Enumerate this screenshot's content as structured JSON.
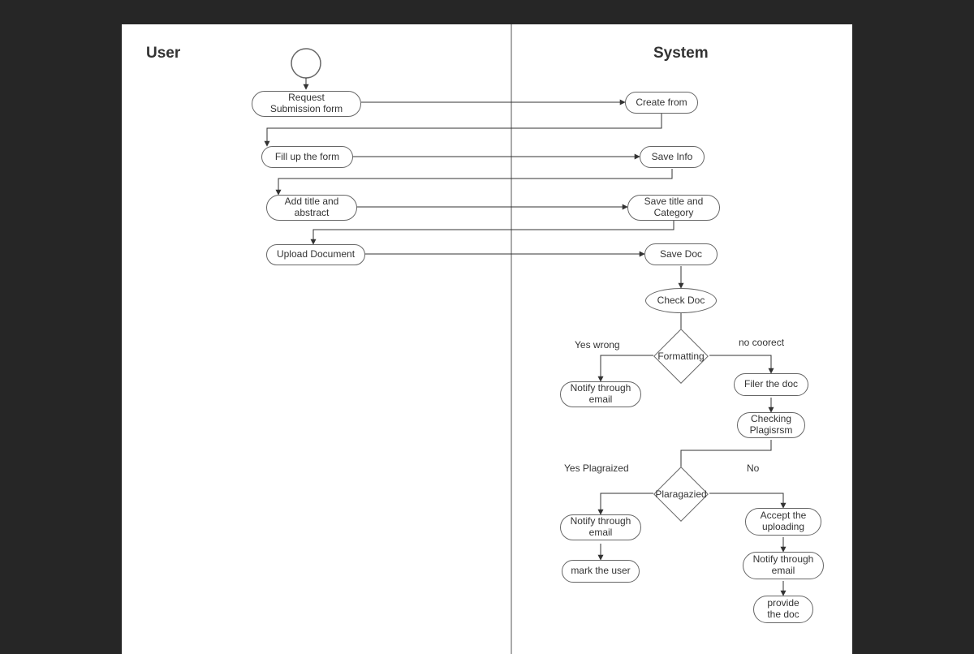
{
  "titles": {
    "user": "User",
    "system": "System"
  },
  "nodes": {
    "request": "Request\nSubmission form",
    "createForm": "Create from",
    "fillForm": "Fill up the form",
    "saveInfo": "Save Info",
    "addTitle": "Add title and\nabstract",
    "saveTitle": "Save title and\nCategory",
    "uploadDoc": "Upload Document",
    "saveDoc": "Save Doc",
    "checkDoc": "Check Doc",
    "notify1": "Notify through\nemail",
    "filterDoc": "Filer the doc",
    "checkPlag": "Checking\nPlagisrsm",
    "notify2": "Notify through\nemail",
    "markUser": "mark the user",
    "accept": "Accept the\nuploading",
    "notify3": "Notify through\nemail",
    "provide": "provide\nthe doc"
  },
  "diamonds": {
    "formatting": "Formatting",
    "plagiarized": "Plaragazied"
  },
  "edgeLabels": {
    "yesWrong": "Yes wrong",
    "noCorrect": "no coorect",
    "yesPlag": "Yes Plagraized",
    "no": "No"
  },
  "chart_data": {
    "type": "activity-diagram",
    "swimlanes": [
      "User",
      "System"
    ],
    "nodes": [
      {
        "id": "start",
        "lane": "User",
        "type": "initial"
      },
      {
        "id": "request",
        "lane": "User",
        "label": "Request Submission form"
      },
      {
        "id": "createForm",
        "lane": "System",
        "label": "Create from"
      },
      {
        "id": "fillForm",
        "lane": "User",
        "label": "Fill up the form"
      },
      {
        "id": "saveInfo",
        "lane": "System",
        "label": "Save Info"
      },
      {
        "id": "addTitle",
        "lane": "User",
        "label": "Add title and abstract"
      },
      {
        "id": "saveTitle",
        "lane": "System",
        "label": "Save title and Category"
      },
      {
        "id": "uploadDoc",
        "lane": "User",
        "label": "Upload Document"
      },
      {
        "id": "saveDoc",
        "lane": "System",
        "label": "Save Doc"
      },
      {
        "id": "checkDoc",
        "lane": "System",
        "label": "Check Doc"
      },
      {
        "id": "formatting",
        "lane": "System",
        "type": "decision",
        "label": "Formatting"
      },
      {
        "id": "notify1",
        "lane": "System",
        "label": "Notify through email"
      },
      {
        "id": "filterDoc",
        "lane": "System",
        "label": "Filer the doc"
      },
      {
        "id": "checkPlag",
        "lane": "System",
        "label": "Checking Plagisrsm"
      },
      {
        "id": "plagiarized",
        "lane": "System",
        "type": "decision",
        "label": "Plaragazied"
      },
      {
        "id": "notify2",
        "lane": "System",
        "label": "Notify through email"
      },
      {
        "id": "markUser",
        "lane": "System",
        "label": "mark the user"
      },
      {
        "id": "accept",
        "lane": "System",
        "label": "Accept the uploading"
      },
      {
        "id": "notify3",
        "lane": "System",
        "label": "Notify through email"
      },
      {
        "id": "provide",
        "lane": "System",
        "label": "provide the doc"
      }
    ],
    "edges": [
      {
        "from": "start",
        "to": "request"
      },
      {
        "from": "request",
        "to": "createForm"
      },
      {
        "from": "createForm",
        "to": "fillForm"
      },
      {
        "from": "fillForm",
        "to": "saveInfo"
      },
      {
        "from": "saveInfo",
        "to": "addTitle"
      },
      {
        "from": "addTitle",
        "to": "saveTitle"
      },
      {
        "from": "saveTitle",
        "to": "uploadDoc"
      },
      {
        "from": "uploadDoc",
        "to": "saveDoc"
      },
      {
        "from": "saveDoc",
        "to": "checkDoc"
      },
      {
        "from": "checkDoc",
        "to": "formatting"
      },
      {
        "from": "formatting",
        "to": "notify1",
        "label": "Yes wrong"
      },
      {
        "from": "formatting",
        "to": "filterDoc",
        "label": "no coorect"
      },
      {
        "from": "filterDoc",
        "to": "checkPlag"
      },
      {
        "from": "checkPlag",
        "to": "plagiarized"
      },
      {
        "from": "plagiarized",
        "to": "notify2",
        "label": "Yes Plagraized"
      },
      {
        "from": "notify2",
        "to": "markUser"
      },
      {
        "from": "plagiarized",
        "to": "accept",
        "label": "No"
      },
      {
        "from": "accept",
        "to": "notify3"
      },
      {
        "from": "notify3",
        "to": "provide"
      }
    ]
  }
}
